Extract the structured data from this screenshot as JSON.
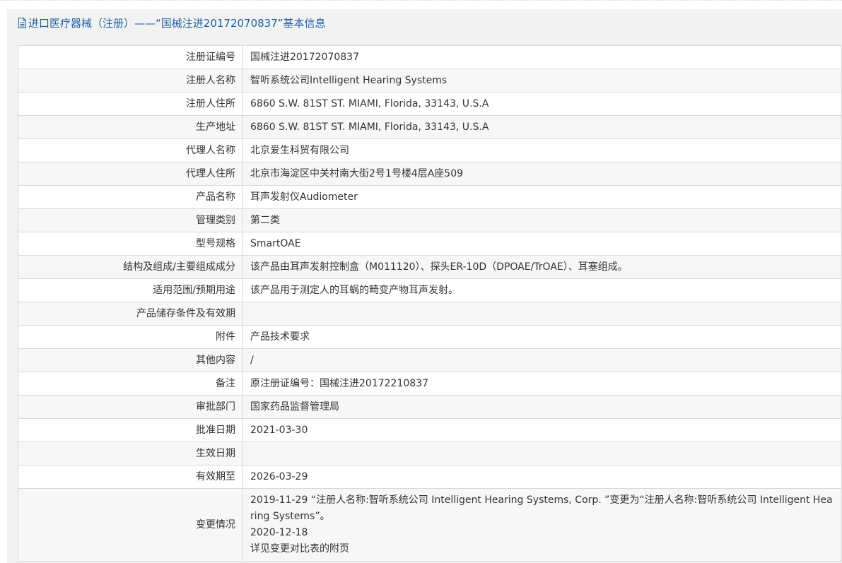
{
  "header": {
    "title": "进口医疗器械（注册）——“国械注进20172070837”基本信息"
  },
  "rows": [
    {
      "label": "注册证编号",
      "value": "国械注进20172070837"
    },
    {
      "label": "注册人名称",
      "value": "智听系统公司Intelligent Hearing Systems"
    },
    {
      "label": "注册人住所",
      "value": "6860 S.W. 81ST ST. MIAMI, Florida, 33143, U.S.A"
    },
    {
      "label": "生产地址",
      "value": "6860 S.W. 81ST ST. MIAMI, Florida, 33143, U.S.A"
    },
    {
      "label": "代理人名称",
      "value": "北京爱生科贸有限公司"
    },
    {
      "label": "代理人住所",
      "value": "北京市海淀区中关村南大街2号1号楼4层A座509"
    },
    {
      "label": "产品名称",
      "value": "耳声发射仪Audiometer"
    },
    {
      "label": "管理类别",
      "value": "第二类"
    },
    {
      "label": "型号规格",
      "value": "SmartOAE"
    },
    {
      "label": "结构及组成/主要组成成分",
      "value": "该产品由耳声发射控制盒（M011120）、探头ER-10D（DPOAE/TrOAE）、耳塞组成。"
    },
    {
      "label": "适用范围/预期用途",
      "value": "该产品用于测定人的耳蜗的畸变产物耳声发射。"
    },
    {
      "label": "产品储存条件及有效期",
      "value": ""
    },
    {
      "label": "附件",
      "value": "产品技术要求"
    },
    {
      "label": "其他内容",
      "value": "/"
    },
    {
      "label": "备注",
      "value": "原注册证编号：国械注进20172210837"
    },
    {
      "label": "审批部门",
      "value": "国家药品监督管理局"
    },
    {
      "label": "批准日期",
      "value": "2021-03-30"
    },
    {
      "label": "生效日期",
      "value": ""
    },
    {
      "label": "有效期至",
      "value": "2026-03-29"
    }
  ],
  "changes": {
    "label": "变更情况",
    "lines": [
      "2019-11-29 “注册人名称:智听系统公司 Intelligent Hearing Systems, Corp. ”变更为“注册人名称:智听系统公司 Intelligent Hearing Systems”。",
      "2020-12-18",
      "详见变更对比表的附页"
    ]
  }
}
